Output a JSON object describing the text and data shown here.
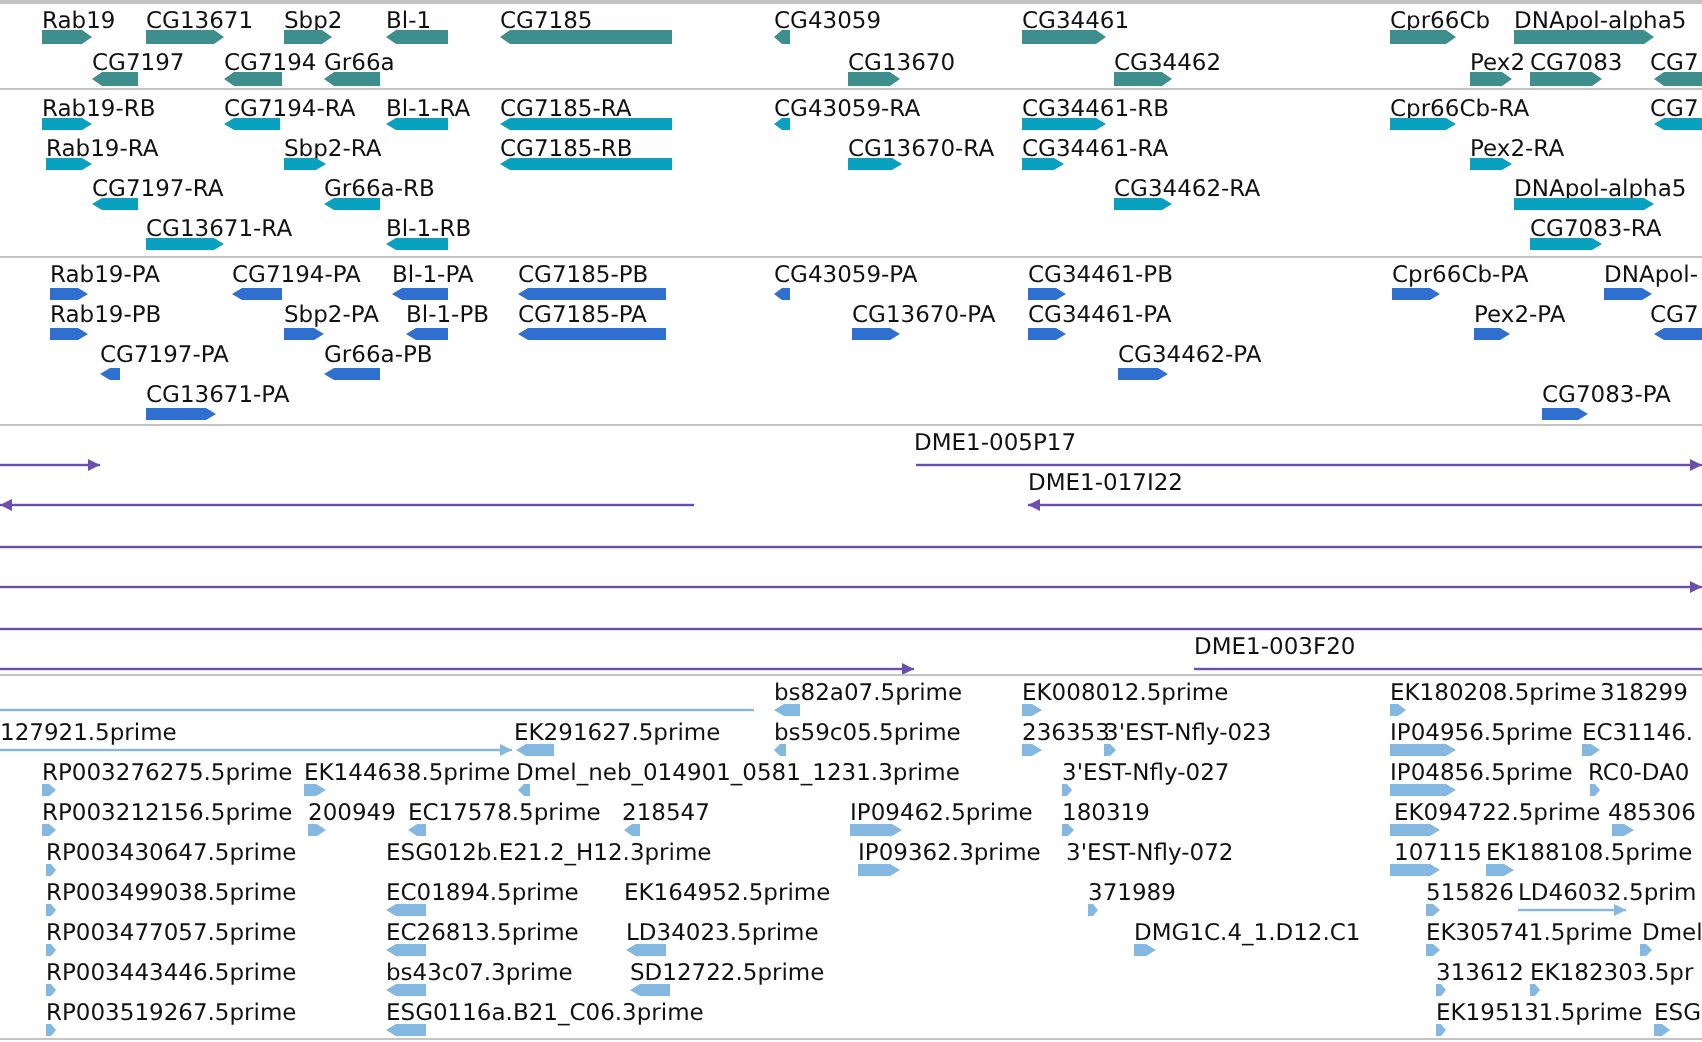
{
  "tracks": [
    {
      "kind": "gene",
      "features": [
        {
          "label": "Rab19",
          "reverse": false
        },
        {
          "label": "CG13671",
          "reverse": false
        },
        {
          "label": "Sbp2",
          "reverse": false
        },
        {
          "label": "Bl-1",
          "reverse": true
        },
        {
          "label": "CG7185",
          "reverse": true
        },
        {
          "label": "CG43059",
          "reverse": true
        },
        {
          "label": "CG34461",
          "reverse": false
        },
        {
          "label": "Cpr66Cb",
          "reverse": false
        },
        {
          "label": "DNApol-alpha5",
          "reverse": false
        },
        {
          "label": "CG7197",
          "reverse": true
        },
        {
          "label": "CG7194",
          "reverse": true
        },
        {
          "label": "Gr66a",
          "reverse": true
        },
        {
          "label": "CG13670",
          "reverse": false
        },
        {
          "label": "CG34462",
          "reverse": false
        },
        {
          "label": "Pex2",
          "reverse": false
        },
        {
          "label": "CG7083",
          "reverse": false
        },
        {
          "label": "CG7",
          "reverse": true
        }
      ]
    },
    {
      "kind": "transcript",
      "features": [
        {
          "label": "Rab19-RB",
          "reverse": false
        },
        {
          "label": "CG7194-RA",
          "reverse": true
        },
        {
          "label": "Bl-1-RA",
          "reverse": true
        },
        {
          "label": "CG7185-RA",
          "reverse": true
        },
        {
          "label": "CG43059-RA",
          "reverse": true
        },
        {
          "label": "CG34461-RB",
          "reverse": false
        },
        {
          "label": "Cpr66Cb-RA",
          "reverse": false
        },
        {
          "label": "CG7",
          "reverse": true
        },
        {
          "label": "Rab19-RA",
          "reverse": false
        },
        {
          "label": "Sbp2-RA",
          "reverse": false
        },
        {
          "label": "CG7185-RB",
          "reverse": true
        },
        {
          "label": "CG13670-RA",
          "reverse": false
        },
        {
          "label": "CG34461-RA",
          "reverse": false
        },
        {
          "label": "Pex2-RA",
          "reverse": false
        },
        {
          "label": "CG7197-RA",
          "reverse": true
        },
        {
          "label": "Gr66a-RB",
          "reverse": true
        },
        {
          "label": "CG34462-RA",
          "reverse": false
        },
        {
          "label": "DNApol-alpha5",
          "reverse": false
        },
        {
          "label": "CG13671-RA",
          "reverse": false
        },
        {
          "label": "Bl-1-RB",
          "reverse": true
        },
        {
          "label": "CG7083-RA",
          "reverse": false
        }
      ]
    },
    {
      "kind": "protein",
      "features": [
        {
          "label": "Rab19-PA",
          "reverse": false
        },
        {
          "label": "CG7194-PA",
          "reverse": true
        },
        {
          "label": "Bl-1-PA",
          "reverse": true
        },
        {
          "label": "CG7185-PB",
          "reverse": true
        },
        {
          "label": "CG43059-PA",
          "reverse": true
        },
        {
          "label": "CG34461-PB",
          "reverse": false
        },
        {
          "label": "Cpr66Cb-PA",
          "reverse": false
        },
        {
          "label": "DNApol-",
          "reverse": false
        },
        {
          "label": "Rab19-PB",
          "reverse": false
        },
        {
          "label": "Sbp2-PA",
          "reverse": false
        },
        {
          "label": "Bl-1-PB",
          "reverse": true
        },
        {
          "label": "CG7185-PA",
          "reverse": true
        },
        {
          "label": "CG13670-PA",
          "reverse": false
        },
        {
          "label": "CG34461-PA",
          "reverse": false
        },
        {
          "label": "Pex2-PA",
          "reverse": false
        },
        {
          "label": "CG7",
          "reverse": true
        },
        {
          "label": "CG7197-PA",
          "reverse": true
        },
        {
          "label": "Gr66a-PB",
          "reverse": true
        },
        {
          "label": "CG34462-PA",
          "reverse": false
        },
        {
          "label": "CG13671-PA",
          "reverse": false
        },
        {
          "label": "CG7083-PA",
          "reverse": false
        }
      ]
    },
    {
      "kind": "clone",
      "features": [
        {
          "reverse": false
        },
        {
          "label": "DME1-005P17",
          "reverse": false
        },
        {
          "reverse": true
        },
        {
          "label": "DME1-017I22",
          "reverse": true
        },
        {
          "arrowhead": false
        },
        {
          "reverse": false
        },
        {
          "arrowhead": false
        },
        {
          "reverse": false
        },
        {
          "label": "DME1-003F20",
          "arrowhead": false
        }
      ]
    },
    {
      "kind": "est",
      "features": [
        {
          "arrowhead": false
        },
        {
          "label": "bs82a07.5prime",
          "reverse": true
        },
        {
          "label": "EK008012.5prime",
          "reverse": false
        },
        {
          "label": "EK180208.5prime",
          "reverse": false
        },
        {
          "label": "318299"
        },
        {
          "label": "127921.5prime",
          "reverse": false
        },
        {
          "label": "EK291627.5prime",
          "reverse": true
        },
        {
          "label": "bs59c05.5prime",
          "reverse": true
        },
        {
          "label": "236353",
          "reverse": false
        },
        {
          "label": "3'EST-Nfly-023",
          "reverse": false
        },
        {
          "label": "IP04956.5prime",
          "reverse": false
        },
        {
          "label": "EC31146.",
          "reverse": false
        },
        {
          "label": "RP003276275.5prime",
          "reverse": false
        },
        {
          "label": "EK144638.5prime",
          "reverse": false
        },
        {
          "label": "Dmel_neb_014901_0581_1231.3prime",
          "reverse": true
        },
        {
          "label": "3'EST-Nfly-027",
          "reverse": false
        },
        {
          "label": "IP04856.5prime",
          "reverse": false
        },
        {
          "label": "RC0-DA0",
          "reverse": false
        },
        {
          "label": "RP003212156.5prime",
          "reverse": false
        },
        {
          "label": "200949",
          "reverse": false
        },
        {
          "label": "EC17578.5prime",
          "reverse": true
        },
        {
          "label": "218547",
          "reverse": true
        },
        {
          "label": "IP09462.5prime",
          "reverse": false
        },
        {
          "label": "180319",
          "reverse": false
        },
        {
          "label": "EK094722.5prime",
          "reverse": false
        },
        {
          "label": "485306",
          "reverse": false
        },
        {
          "label": "RP003430647.5prime",
          "reverse": false
        },
        {
          "label": "ESG012b.E21.2_H12.3prime"
        },
        {
          "label": "IP09362.3prime",
          "reverse": false
        },
        {
          "label": "3'EST-Nfly-072"
        },
        {
          "label": "107115",
          "reverse": false
        },
        {
          "label": "EK188108.5prime",
          "reverse": false
        },
        {
          "label": "RP003499038.5prime",
          "reverse": false
        },
        {
          "label": "EC01894.5prime",
          "reverse": true
        },
        {
          "label": "EK164952.5prime"
        },
        {
          "label": "371989",
          "reverse": false
        },
        {
          "label": "515826",
          "reverse": false
        },
        {
          "label": "LD46032.5prim",
          "reverse": false
        },
        {
          "label": "RP003477057.5prime",
          "reverse": false
        },
        {
          "label": "EC26813.5prime",
          "reverse": true
        },
        {
          "label": "LD34023.5prime",
          "reverse": true
        },
        {
          "label": "DMG1C.4_1.D12.C1",
          "reverse": false
        },
        {
          "label": "EK305741.5prime",
          "reverse": false
        },
        {
          "label": "Dmel",
          "reverse": false
        },
        {
          "label": "RP003443446.5prime",
          "reverse": false
        },
        {
          "label": "bs43c07.3prime",
          "reverse": true
        },
        {
          "label": "SD12722.5prime",
          "reverse": true
        },
        {
          "label": "313612",
          "reverse": false
        },
        {
          "label": "EK182303.5pr",
          "reverse": false
        },
        {
          "label": "RP003519267.5prime",
          "reverse": false
        },
        {
          "label": "ESG0116a.B21_C06.3prime",
          "reverse": true
        },
        {
          "label": "EK195131.5prime",
          "reverse": false
        },
        {
          "label": "ESG",
          "reverse": false
        }
      ]
    }
  ]
}
